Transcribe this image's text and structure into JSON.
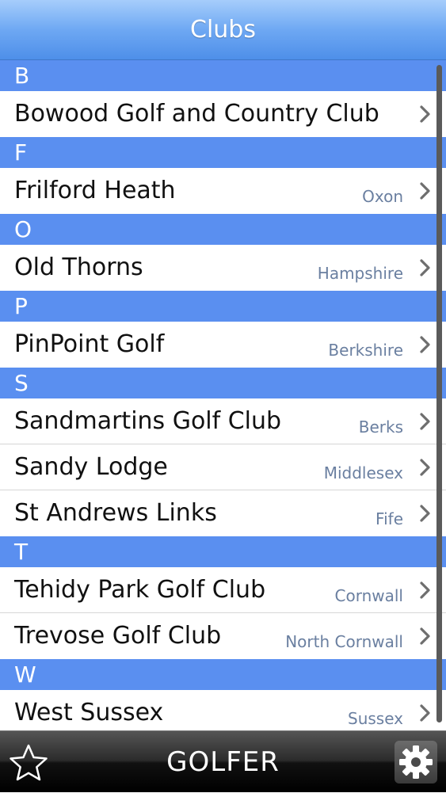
{
  "header": {
    "title": "Clubs"
  },
  "sections": [
    {
      "letter": "B",
      "clubs": [
        {
          "name": "Bowood Golf and Country Club",
          "region": ""
        }
      ]
    },
    {
      "letter": "F",
      "clubs": [
        {
          "name": "Frilford Heath",
          "region": "Oxon"
        }
      ]
    },
    {
      "letter": "O",
      "clubs": [
        {
          "name": "Old Thorns",
          "region": "Hampshire"
        }
      ]
    },
    {
      "letter": "P",
      "clubs": [
        {
          "name": "PinPoint Golf",
          "region": "Berkshire"
        }
      ]
    },
    {
      "letter": "S",
      "clubs": [
        {
          "name": "Sandmartins Golf Club",
          "region": "Berks"
        },
        {
          "name": "Sandy Lodge",
          "region": "Middlesex"
        },
        {
          "name": "St Andrews Links",
          "region": "Fife"
        }
      ]
    },
    {
      "letter": "T",
      "clubs": [
        {
          "name": "Tehidy Park Golf Club",
          "region": "Cornwall"
        },
        {
          "name": "Trevose Golf Club",
          "region": "North Cornwall"
        }
      ]
    },
    {
      "letter": "W",
      "clubs": [
        {
          "name": "West Sussex",
          "region": "Sussex"
        }
      ]
    }
  ],
  "tabbar": {
    "title": "GOLFER",
    "favorites_icon": "star-outline-icon",
    "settings_icon": "gear-icon"
  },
  "colors": {
    "header_top": "#a6cdfb",
    "header_bottom": "#4e8fe9",
    "section_header": "#5a8ff0",
    "region_text": "#6a7fa0",
    "chevron": "#6e6e6e",
    "tabbar": "#1a1a1a"
  }
}
